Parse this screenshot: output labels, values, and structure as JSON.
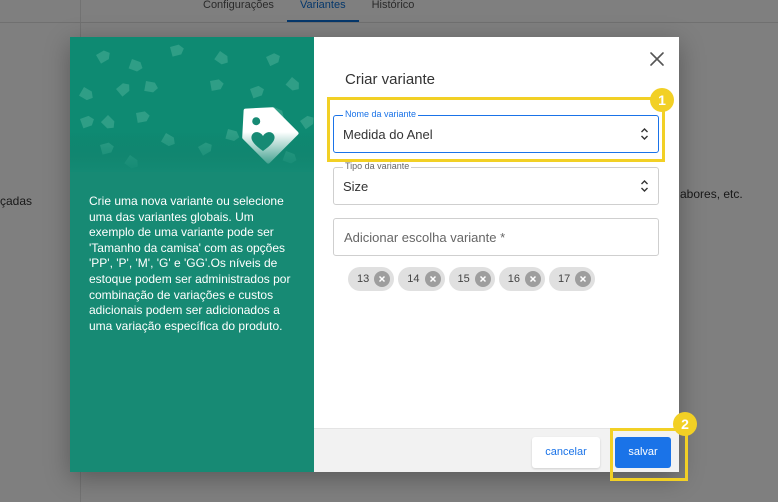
{
  "background": {
    "tabs": [
      {
        "label": "Configurações",
        "active": false
      },
      {
        "label": "Variantes",
        "active": true
      },
      {
        "label": "Histórico",
        "active": false
      }
    ],
    "left_fragment": "çadas",
    "right_fragment": "abores, etc."
  },
  "modal": {
    "left_panel": {
      "icon": "tag-heart-icon",
      "description": "Crie uma nova variante ou selecione uma das variantes globais. Um exemplo de uma variante pode ser 'Tamanho da camisa' com as opções 'PP', 'P', 'M', 'G' e 'GG'.Os níveis de estoque podem ser administrados por combinação de variações e custos adicionais podem ser adicionados a uma variação específica do produto."
    },
    "title": "Criar variante",
    "fields": {
      "variant_name": {
        "label": "Nome da variante",
        "value": "Medida do Anel"
      },
      "variant_type": {
        "label": "Tipo da variante",
        "value": "Size"
      },
      "add_choice": {
        "placeholder": "Adicionar escolha variante *"
      }
    },
    "chips": [
      "13",
      "14",
      "15",
      "16",
      "17"
    ],
    "buttons": {
      "cancel": "cancelar",
      "save": "salvar"
    }
  },
  "annotations": {
    "badge_1": "1",
    "badge_2": "2",
    "highlight_color": "#f2d025"
  },
  "colors": {
    "panel_green": "#178a74",
    "accent_blue": "#1a73e8"
  }
}
